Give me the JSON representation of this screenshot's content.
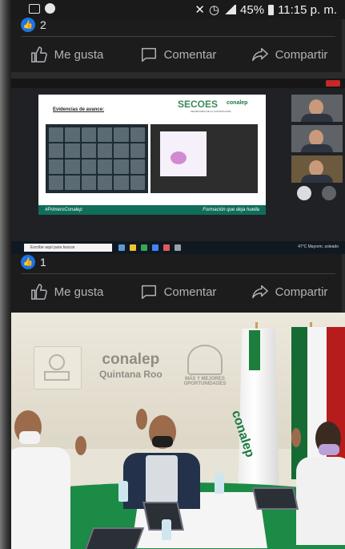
{
  "status_bar": {
    "battery": "45%",
    "time": "11:15 p. m."
  },
  "post1": {
    "likes_count": "2",
    "actions": {
      "like": "Me gusta",
      "comment": "Comentar",
      "share": "Compartir"
    }
  },
  "screenshot": {
    "slide_title": "Evidencias de avance:",
    "org_name": "SECOES",
    "org_subtitle": "SECRETARÍA DE LA CONTRALORÍA",
    "conalep_brand": "conalep",
    "conalep_region": "Quintana Roo",
    "hashtag": "#PrimeroConalep",
    "tagline": "Formación que deja huella",
    "taskbar_search": "Escribe aquí para buscar",
    "weather": "47°C Mayorm. soleado"
  },
  "post2": {
    "likes_count": "1",
    "actions": {
      "like": "Me gusta",
      "comment": "Comentar",
      "share": "Compartir"
    }
  },
  "photo": {
    "wall_logo": "conalep",
    "wall_logo_sub": "Quintana Roo",
    "wall_logo_right": "MÁS Y MEJORES OPORTUNIDADES",
    "flag_text": "conalep"
  }
}
